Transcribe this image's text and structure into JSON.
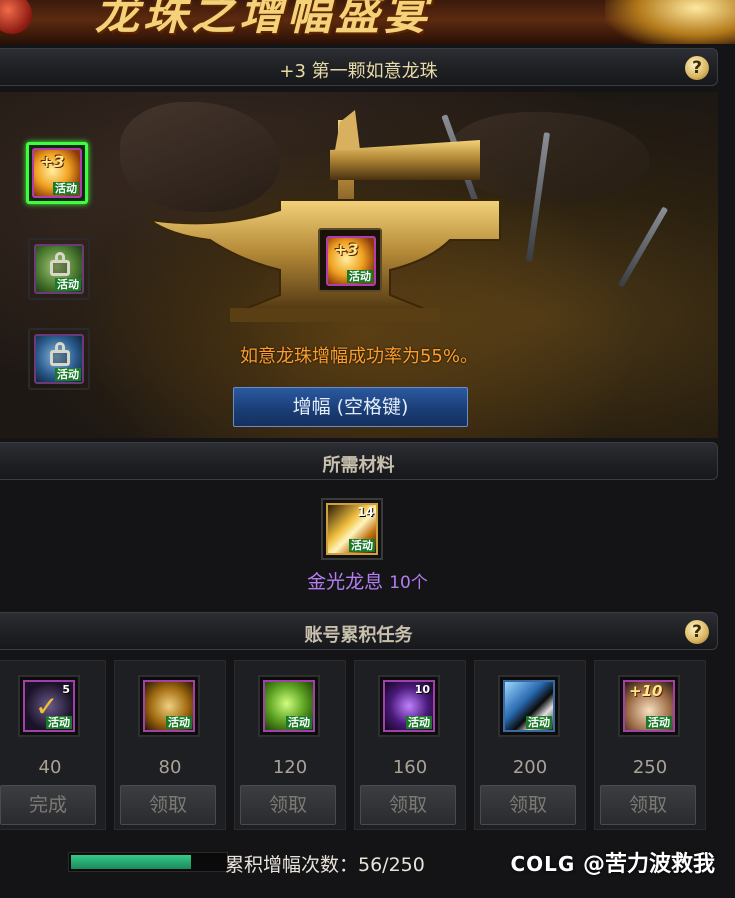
{
  "banner": {
    "title": "龙珠之增幅盛宴"
  },
  "header": {
    "title": "+3 第一颗如意龙珠",
    "help_icon": "?"
  },
  "slots": [
    {
      "plus": "+3",
      "tag": "活动",
      "state": "active"
    },
    {
      "tag": "活动",
      "state": "locked"
    },
    {
      "tag": "活动",
      "state": "locked"
    }
  ],
  "forge": {
    "center_item": {
      "plus": "+3",
      "tag": "活动"
    },
    "rate_text": "如意龙珠增幅成功率为55%。",
    "enhance_button": "增幅 (空格键)"
  },
  "materials": {
    "title": "所需材料",
    "item": {
      "count_badge": "14",
      "tag": "活动",
      "name": "金光龙息",
      "quantity": "10个"
    }
  },
  "tasks": {
    "title": "账号累积任务",
    "help_icon": "?",
    "items": [
      {
        "threshold": "40",
        "button": "完成",
        "badge": "5",
        "tag": "活动"
      },
      {
        "threshold": "80",
        "button": "领取",
        "badge": "",
        "tag": "活动"
      },
      {
        "threshold": "120",
        "button": "领取",
        "badge": "",
        "tag": "活动"
      },
      {
        "threshold": "160",
        "button": "领取",
        "badge": "10",
        "tag": "活动"
      },
      {
        "threshold": "200",
        "button": "领取",
        "badge": "",
        "tag": "活动"
      },
      {
        "threshold": "250",
        "button": "领取",
        "badge": "+10",
        "tag": "活动"
      }
    ]
  },
  "progress": {
    "label": "累积增幅次数：56/250",
    "value": 56,
    "max": 250
  },
  "watermark": {
    "brand": "COLG",
    "user": "@苦力波救我"
  },
  "colors": {
    "accent_green": "#3dff3d",
    "rate_orange": "#ff9e2a",
    "material_purple": "#b37ef0",
    "button_blue": "#1b3e78"
  }
}
